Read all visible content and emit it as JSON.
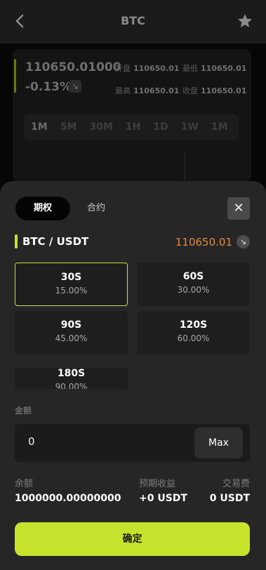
{
  "header": {
    "title": "BTC",
    "back_icon": "chevron-left-icon",
    "favorite_icon": "star-icon"
  },
  "quote": {
    "price": "110650.01000",
    "change": "-0.13%",
    "stats": [
      {
        "label": "开盘",
        "value": "110650.01"
      },
      {
        "label": "最低",
        "value": "110650.01"
      },
      {
        "label": "最高",
        "value": "110650.01"
      },
      {
        "label": "收盘",
        "value": "110650.01"
      }
    ],
    "periods": [
      "1M",
      "5M",
      "30M",
      "1H",
      "1D",
      "1W",
      "1M"
    ],
    "active_period": "1M"
  },
  "sheet": {
    "tabs": [
      "期权",
      "合约"
    ],
    "active_tab": "期权",
    "close_label": "✕",
    "pair": {
      "name": "BTC / USDT",
      "price": "110650.01",
      "arrow_icon": "arrow-down-right-icon"
    },
    "options": [
      {
        "duration": "30S",
        "rate": "15.00%",
        "selected": true
      },
      {
        "duration": "60S",
        "rate": "30.00%",
        "selected": false
      },
      {
        "duration": "90S",
        "rate": "45.00%",
        "selected": false
      },
      {
        "duration": "120S",
        "rate": "60.00%",
        "selected": false
      },
      {
        "duration": "180S",
        "rate": "90.00%",
        "selected": false
      }
    ],
    "amount_label": "金额",
    "amount_value": "0",
    "max_label": "Max",
    "info": [
      {
        "label": "余额",
        "value": "1000000.00000000"
      },
      {
        "label": "预期收益",
        "value": "+0 USDT"
      },
      {
        "label": "交易费",
        "value": "0 USDT"
      }
    ],
    "confirm_label": "确定"
  },
  "colors": {
    "accent": "#c6e22d",
    "price": "#e08a3a",
    "sheet_bg": "#262626",
    "card_bg": "#1e1e1e"
  }
}
